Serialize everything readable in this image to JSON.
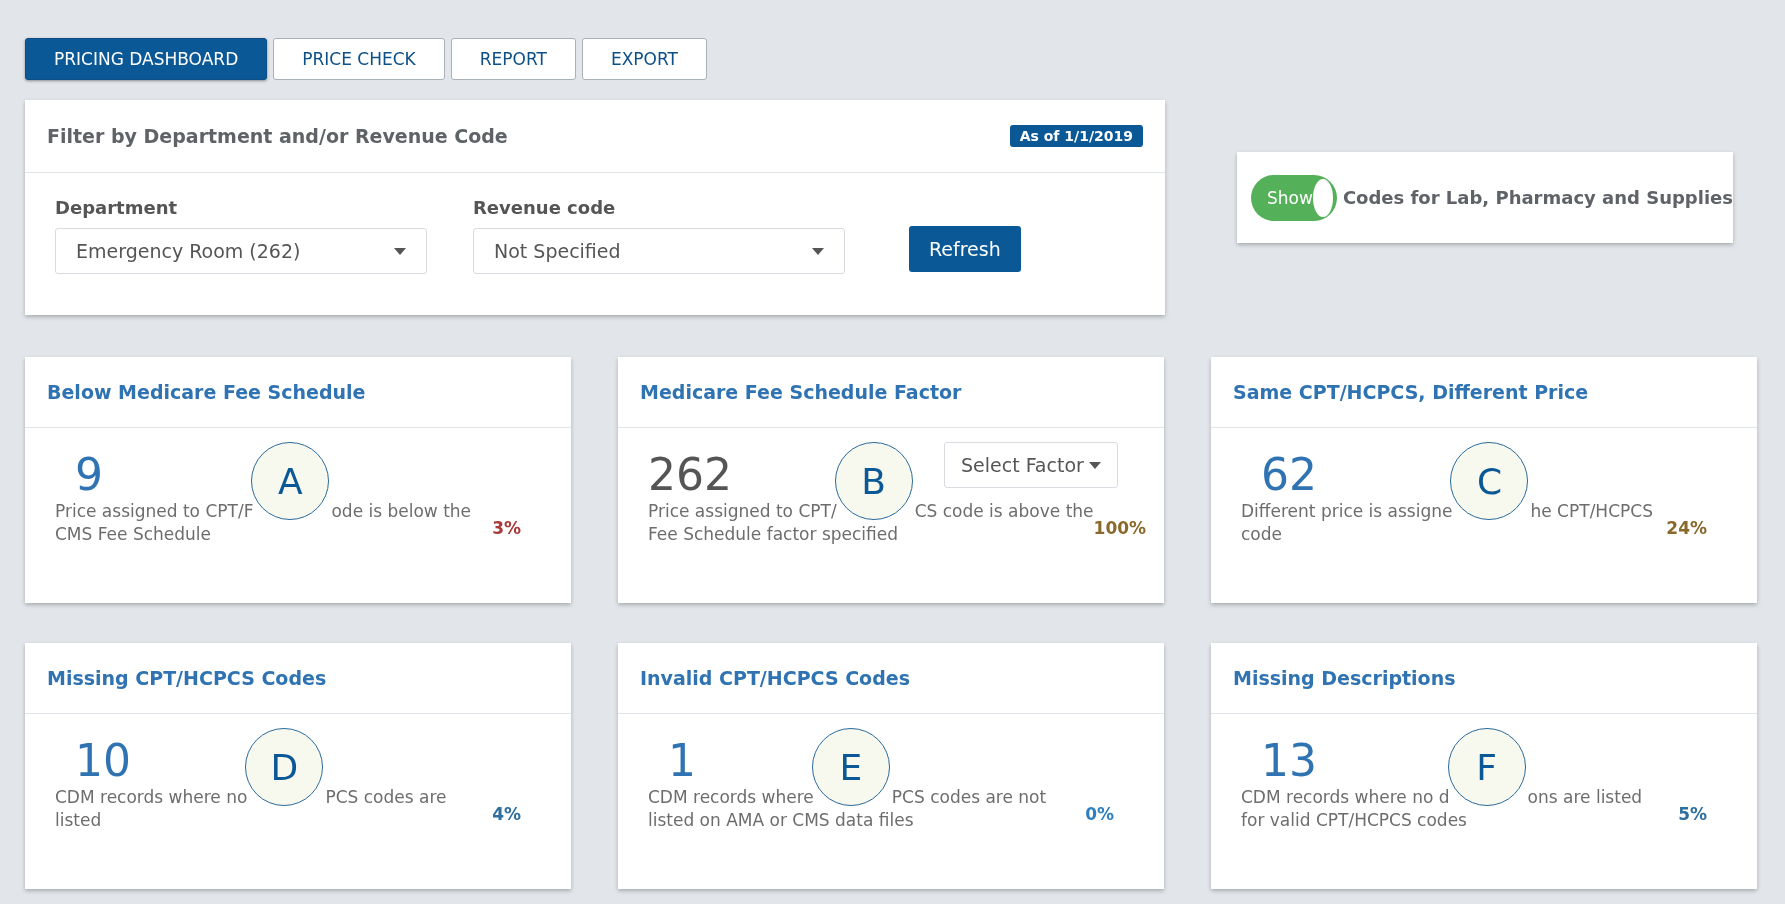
{
  "tabs": [
    {
      "label": "PRICING DASHBOARD",
      "selected": true
    },
    {
      "label": "PRICE CHECK",
      "selected": false
    },
    {
      "label": "REPORT",
      "selected": false
    },
    {
      "label": "EXPORT",
      "selected": false
    }
  ],
  "filter": {
    "title": "Filter by Department and/or Revenue Code",
    "badge": "As of 1/1/2019",
    "fields": [
      {
        "label": "Department",
        "value": "Emergency Room (262)"
      },
      {
        "label": "Revenue code",
        "value": "Not Specified"
      }
    ],
    "button": "Refresh"
  },
  "toggle": {
    "on": true,
    "label": "Show",
    "text": "Codes for Lab, Pharmacy and Supplies"
  },
  "cards": [
    {
      "title": "Below Medicare Fee Schedule",
      "count": "9",
      "count_muted": false,
      "marker": "A",
      "desc_before": "Price assigned to CPT/F",
      "desc_after": "ode is below the",
      "desc_rest": "CMS Fee Schedule",
      "percent": "3%",
      "color": "#a83a3a"
    },
    {
      "title": "Medicare Fee Schedule Factor",
      "count": "262",
      "count_muted": true,
      "marker": "B",
      "desc_before": "Price assigned to CPT/",
      "desc_after": "CS code is above the",
      "desc_rest": "Fee Schedule factor specified",
      "percent": "100%",
      "color": "#8a6a2c",
      "select": "Select Factor"
    },
    {
      "title": "Same CPT/HCPCS, Different Price",
      "count": "62",
      "count_muted": false,
      "marker": "C",
      "desc_before": "Different price is assigne",
      "desc_after": "he CPT/HCPCS",
      "desc_rest": "code",
      "percent": "24%",
      "color": "#8a6a2c"
    },
    {
      "title": "Missing CPT/HCPCS Codes",
      "count": "10",
      "count_muted": false,
      "marker": "D",
      "desc_before": "CDM records where no",
      "desc_after": "PCS codes are",
      "desc_rest": "listed",
      "percent": "4%",
      "color": "#2f6f9f"
    },
    {
      "title": "Invalid CPT/HCPCS Codes",
      "count": "1",
      "count_muted": false,
      "marker": "E",
      "desc_before": "CDM records where",
      "desc_after": "PCS codes are not",
      "desc_rest": "listed on AMA or CMS data files",
      "percent": "0%",
      "color": "#2f7fc0"
    },
    {
      "title": "Missing Descriptions",
      "count": "13",
      "count_muted": false,
      "marker": "F",
      "desc_before": "CDM records where no d",
      "desc_after": "ons are listed",
      "desc_rest": "for valid CPT/HCPCS codes",
      "percent": "5%",
      "color": "#2f6f9f"
    }
  ]
}
